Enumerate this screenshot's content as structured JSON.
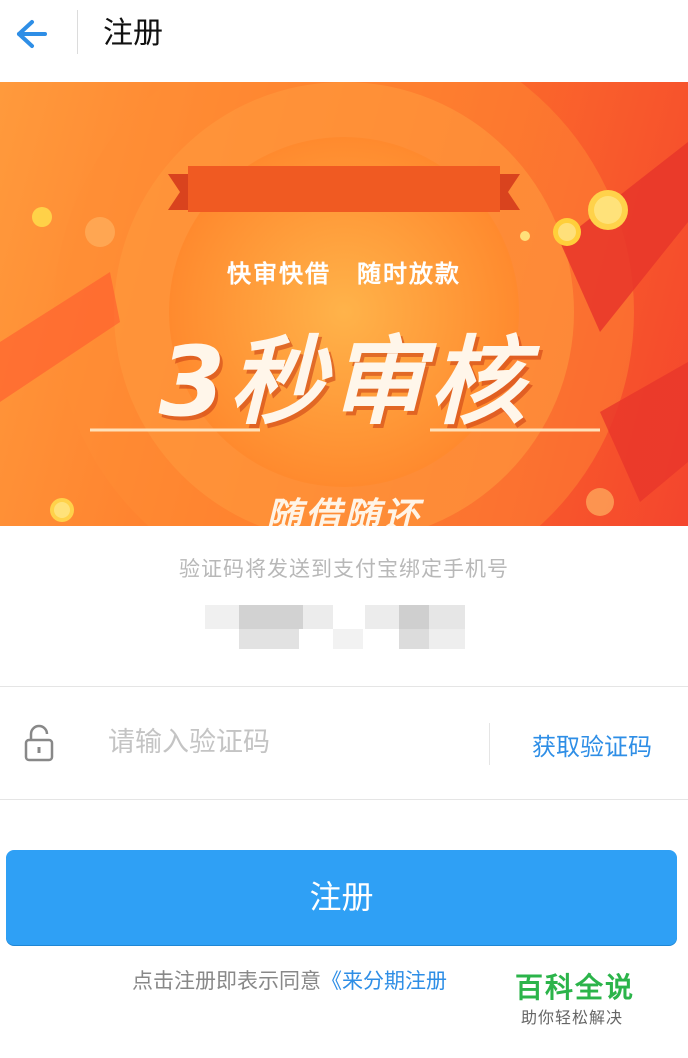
{
  "nav": {
    "title": "注册",
    "back_icon": "arrow-left-icon"
  },
  "banner": {
    "ribbon": "快审快借　随时放款",
    "headline": "3秒审核",
    "subline": "随借随还"
  },
  "hint": "验证码将发送到支付宝绑定手机号",
  "code_field": {
    "placeholder": "请输入验证码",
    "value": "",
    "lock_icon": "lock-icon"
  },
  "get_code_label": "获取验证码",
  "register_label": "注册",
  "agreement": {
    "prefix": "点击注册即表示同意",
    "link": "《来分期注册"
  },
  "watermark": {
    "title": "百科全说",
    "subtitle": "助你轻松解决"
  },
  "colors": {
    "accent": "#2fa0f5",
    "link": "#2e8ee6",
    "banner_orange": "#ff7a2a"
  }
}
